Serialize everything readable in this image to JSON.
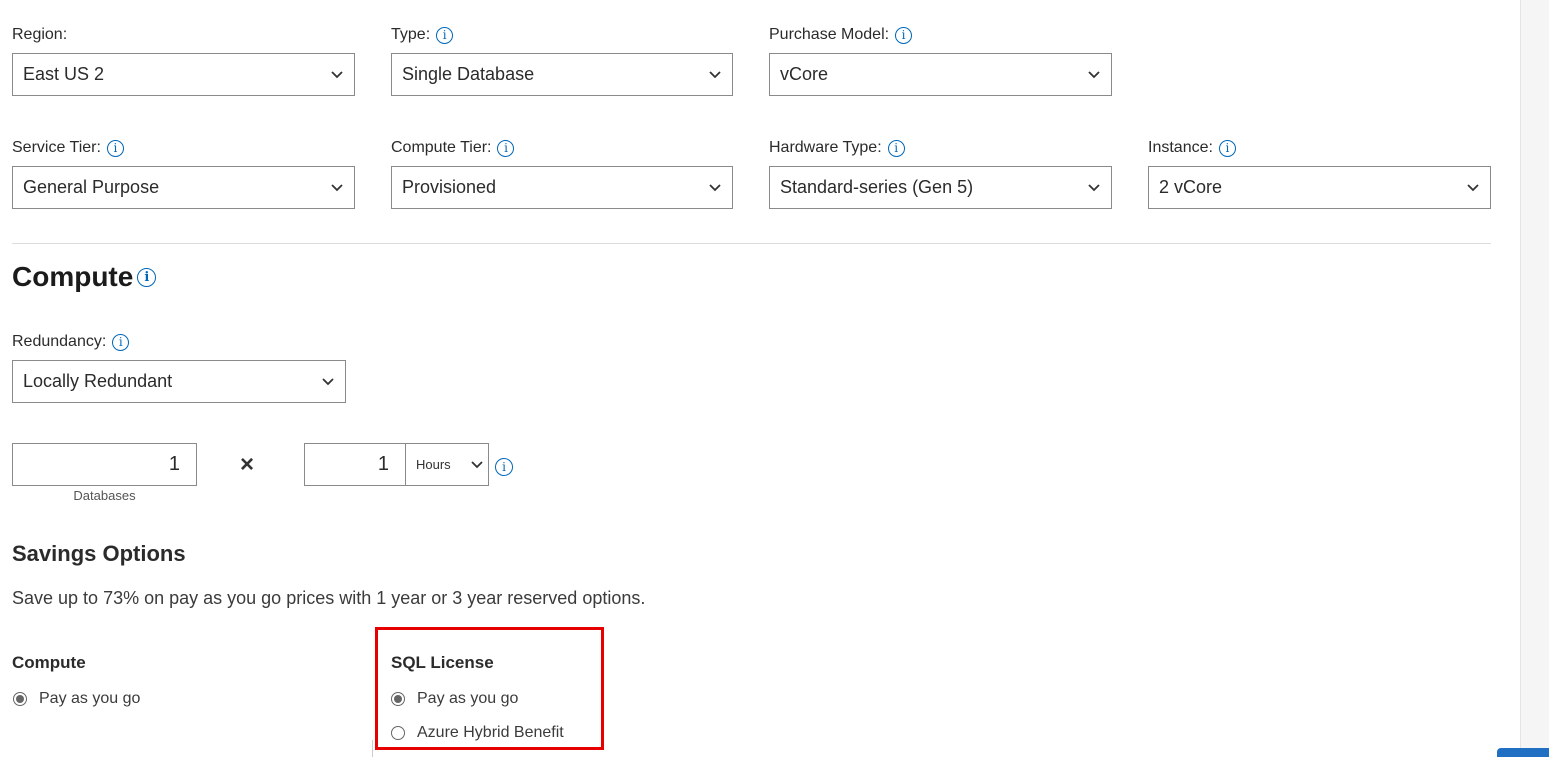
{
  "filters_row1": {
    "region": {
      "label": "Region:",
      "value": "East US 2"
    },
    "type": {
      "label": "Type:",
      "value": "Single Database"
    },
    "purchase_model": {
      "label": "Purchase Model:",
      "value": "vCore"
    }
  },
  "filters_row2": {
    "service_tier": {
      "label": "Service Tier:",
      "value": "General Purpose"
    },
    "compute_tier": {
      "label": "Compute Tier:",
      "value": "Provisioned"
    },
    "hardware_type": {
      "label": "Hardware Type:",
      "value": "Standard-series (Gen 5)"
    },
    "instance": {
      "label": "Instance:",
      "value": "2 vCore"
    }
  },
  "compute": {
    "heading": "Compute",
    "redundancy": {
      "label": "Redundancy:",
      "value": "Locally Redundant"
    },
    "databases": {
      "value": "1",
      "caption": "Databases"
    },
    "multiply_symbol": "×",
    "hours": {
      "value": "1",
      "unit": "Hours"
    }
  },
  "savings": {
    "heading": "Savings Options",
    "description": "Save up to 73% on pay as you go prices with 1 year or 3 year reserved options.",
    "compute_group": {
      "title": "Compute",
      "options": [
        {
          "label": "Pay as you go",
          "selected": true
        }
      ]
    },
    "license_group": {
      "title": "SQL License",
      "options": [
        {
          "label": "Pay as you go",
          "selected": true
        },
        {
          "label": "Azure Hybrid Benefit",
          "selected": false
        }
      ]
    }
  },
  "icons": {
    "info": "i",
    "chevron": "chevron-down-icon"
  },
  "colors": {
    "accent": "#0067b8",
    "highlight_box": "#e60000"
  }
}
